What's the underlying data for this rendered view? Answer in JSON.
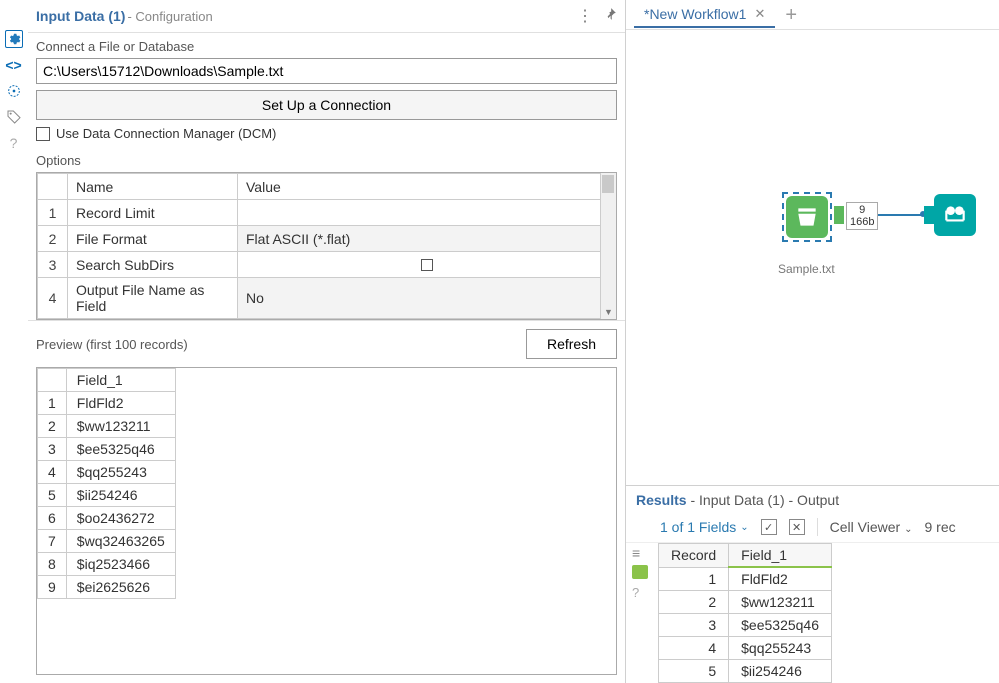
{
  "config_panel": {
    "title": "Input Data (1)",
    "subtitle": " - Configuration",
    "connect_label": "Connect a File or Database",
    "file_path": "C:\\Users\\15712\\Downloads\\Sample.txt",
    "setup_btn": "Set Up a Connection",
    "dcm_label": "Use Data Connection Manager (DCM)",
    "options_label": "Options",
    "options_headers": {
      "name": "Name",
      "value": "Value"
    },
    "options": [
      {
        "n": "1",
        "name": "Record Limit",
        "value": "",
        "dd": false,
        "cb": false
      },
      {
        "n": "2",
        "name": "File Format",
        "value": "Flat ASCII (*.flat)",
        "dd": true,
        "cb": false
      },
      {
        "n": "3",
        "name": "Search SubDirs",
        "value": "",
        "dd": false,
        "cb": true
      },
      {
        "n": "4",
        "name": "Output File Name as Field",
        "value": "No",
        "dd": true,
        "cb": false
      }
    ],
    "preview_label": "Preview (first 100 records)",
    "refresh_btn": "Refresh",
    "preview_header": "Field_1",
    "preview_rows": [
      {
        "n": "1",
        "v": "FldFld2"
      },
      {
        "n": "2",
        "v": "$ww123211"
      },
      {
        "n": "3",
        "v": "$ee5325q46"
      },
      {
        "n": "4",
        "v": "$qq255243"
      },
      {
        "n": "5",
        "v": "$ii254246"
      },
      {
        "n": "6",
        "v": "$oo2436272"
      },
      {
        "n": "7",
        "v": "$wq32463265"
      },
      {
        "n": "8",
        "v": "$iq2523466"
      },
      {
        "n": "9",
        "v": "$ei2625626"
      }
    ]
  },
  "tabs": {
    "active": "*New Workflow1"
  },
  "canvas": {
    "node_label": "Sample.txt",
    "info_top": "9",
    "info_bot": "166b"
  },
  "results": {
    "title": "Results",
    "subtitle": " - Input Data (1) - Output",
    "fields_link": "1 of 1 Fields",
    "cell_viewer": "Cell Viewer",
    "rec_count": "9 rec",
    "headers": {
      "record": "Record",
      "f1": "Field_1"
    },
    "rows": [
      {
        "n": "1",
        "v": "FldFld2"
      },
      {
        "n": "2",
        "v": "$ww123211"
      },
      {
        "n": "3",
        "v": "$ee5325q46"
      },
      {
        "n": "4",
        "v": "$qq255243"
      },
      {
        "n": "5",
        "v": "$ii254246"
      }
    ]
  }
}
